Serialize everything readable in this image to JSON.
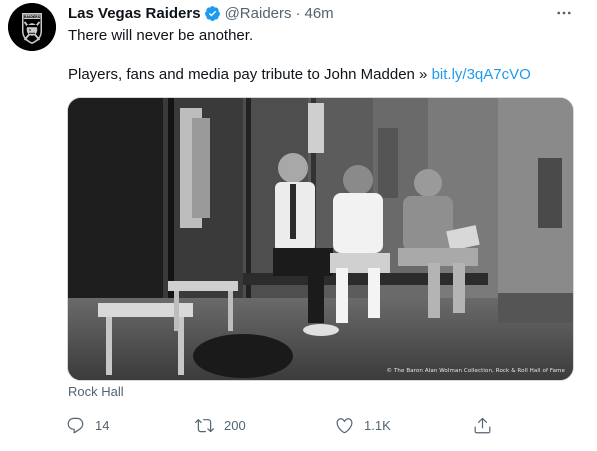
{
  "tweet": {
    "display_name": "Las Vegas Raiders",
    "handle": "@Raiders",
    "separator": "·",
    "time": "46m",
    "line1": "There will never be another.",
    "line2_text": "Players, fans and media pay tribute to John Madden » ",
    "line2_link": "bit.ly/3qA7cVO",
    "avatar_text": "RAIDERS",
    "media_credit": "© The Baron Alan Wolman Collection, Rock & Roll Hall of Fame",
    "source": "Rock Hall"
  },
  "actions": {
    "reply_icon": "reply-icon",
    "reply_count": "14",
    "retweet_icon": "retweet-icon",
    "retweet_count": "200",
    "like_icon": "heart-icon",
    "like_count": "1.1K",
    "share_icon": "share-icon"
  },
  "colors": {
    "link": "#1d9bf0",
    "secondary_text": "#536471",
    "verified": "#1d9bf0"
  }
}
